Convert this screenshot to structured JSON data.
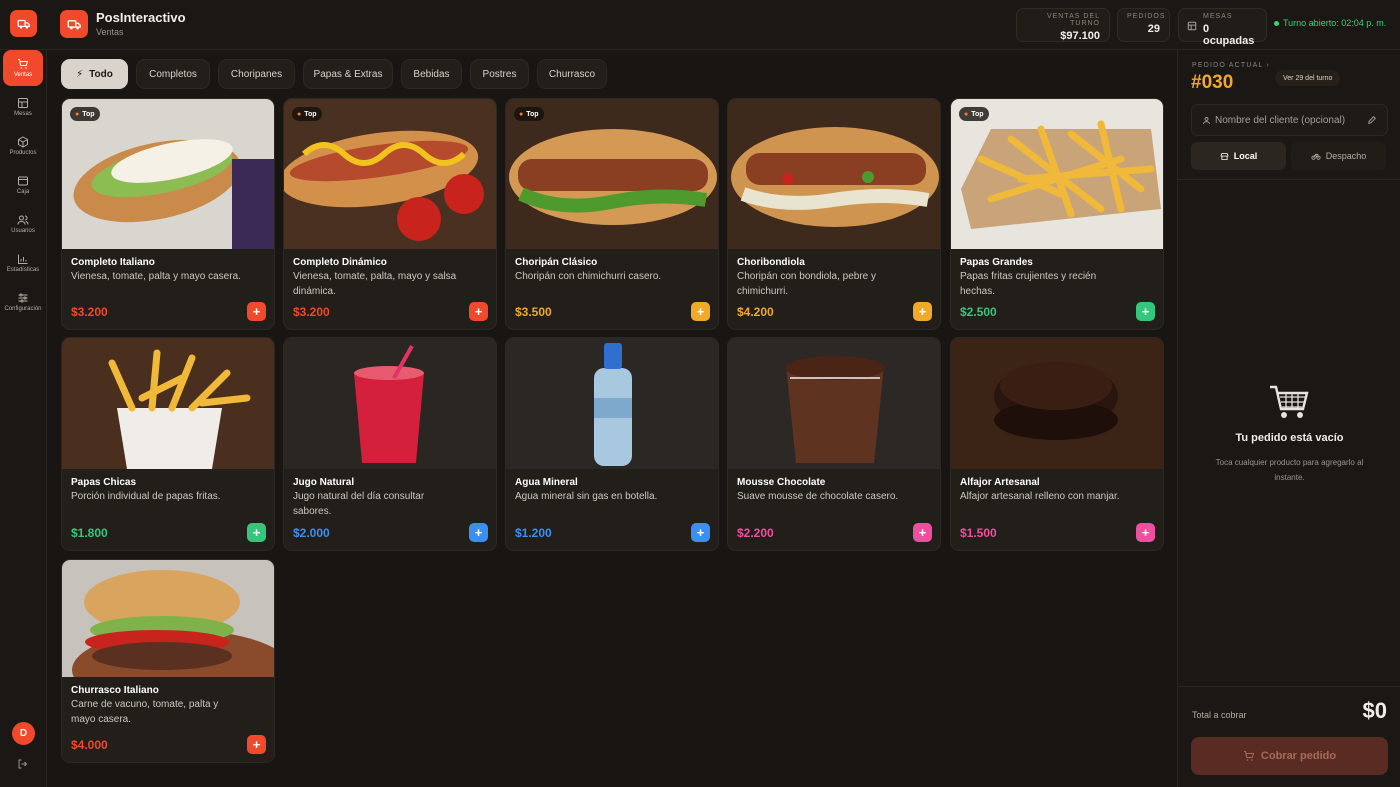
{
  "app": {
    "name": "PosInteractivo",
    "section": "Ventas"
  },
  "header": {
    "stats": [
      {
        "label": "VENTAS DEL TURNO",
        "value": "$97.100"
      },
      {
        "label": "PEDIDOS",
        "value": "29"
      },
      {
        "label": "MESAS",
        "value": "0 ocupadas"
      }
    ],
    "shift": "Turno abierto: 02:04 p. m."
  },
  "sidebar": {
    "items": [
      {
        "label": "Ventas",
        "icon": "cart-icon"
      },
      {
        "label": "Mesas",
        "icon": "table-icon"
      },
      {
        "label": "Productos",
        "icon": "box-icon"
      },
      {
        "label": "Caja",
        "icon": "cashbox-icon"
      },
      {
        "label": "Usuarios",
        "icon": "users-icon"
      },
      {
        "label": "Estadísticas",
        "icon": "chart-icon"
      },
      {
        "label": "Configuración",
        "icon": "settings-icon"
      }
    ],
    "user_initial": "D"
  },
  "categories": [
    "Todo",
    "Completos",
    "Choripanes",
    "Papas & Extras",
    "Bebidas",
    "Postres",
    "Churrasco"
  ],
  "products": [
    {
      "name": "Completo Italiano",
      "desc": "Vienesa, tomate, palta y mayo casera.",
      "price": "$3.200",
      "badge": "Top",
      "color": "#f0492b"
    },
    {
      "name": "Completo Dinámico",
      "desc": "Vienesa, tomate, palta, mayo y salsa dinámica.",
      "price": "$3.200",
      "badge": "Top",
      "color": "#f0492b"
    },
    {
      "name": "Choripán Clásico",
      "desc": "Choripán con chimichurri casero.",
      "price": "$3.500",
      "badge": "Top",
      "color": "#f0a92a"
    },
    {
      "name": "Choribondiola",
      "desc": "Choripán con bondiola, pebre y chimichurri.",
      "price": "$4.200",
      "badge": "",
      "color": "#f0a92a"
    },
    {
      "name": "Papas Grandes",
      "desc": "Papas fritas crujientes y recién hechas.",
      "price": "$2.500",
      "badge": "Top",
      "color": "#34c77b"
    },
    {
      "name": "Papas Chicas",
      "desc": "Porción individual de papas fritas.",
      "price": "$1.800",
      "badge": "",
      "color": "#34c77b"
    },
    {
      "name": "Jugo Natural",
      "desc": "Jugo natural del día consultar sabores.",
      "price": "$2.000",
      "badge": "",
      "color": "#3b8ff2"
    },
    {
      "name": "Agua Mineral",
      "desc": "Agua mineral sin gas en botella.",
      "price": "$1.200",
      "badge": "",
      "color": "#3b8ff2"
    },
    {
      "name": "Mousse Chocolate",
      "desc": "Suave mousse de chocolate casero.",
      "price": "$2.200",
      "badge": "",
      "color": "#ef4f9e"
    },
    {
      "name": "Alfajor Artesanal",
      "desc": "Alfajor artesanal relleno con manjar.",
      "price": "$1.500",
      "badge": "",
      "color": "#ef4f9e"
    },
    {
      "name": "Churrasco Italiano",
      "desc": "Carne de vacuno, tomate, palta y mayo casera.",
      "price": "$4.000",
      "badge": "",
      "color": "#f0492b"
    }
  ],
  "order": {
    "label": "PEDIDO ACTUAL",
    "number": "#030",
    "shift_link": "Ver 29 del turno",
    "customer_placeholder": "Nombre del cliente (opcional)",
    "mode_local": "Local",
    "mode_delivery": "Despacho",
    "empty_title": "Tu pedido está vacío",
    "empty_sub": "Toca cualquier producto para agregarlo al instante.",
    "total_label": "Total a cobrar",
    "total": "$0",
    "checkout": "Cobrar pedido"
  }
}
